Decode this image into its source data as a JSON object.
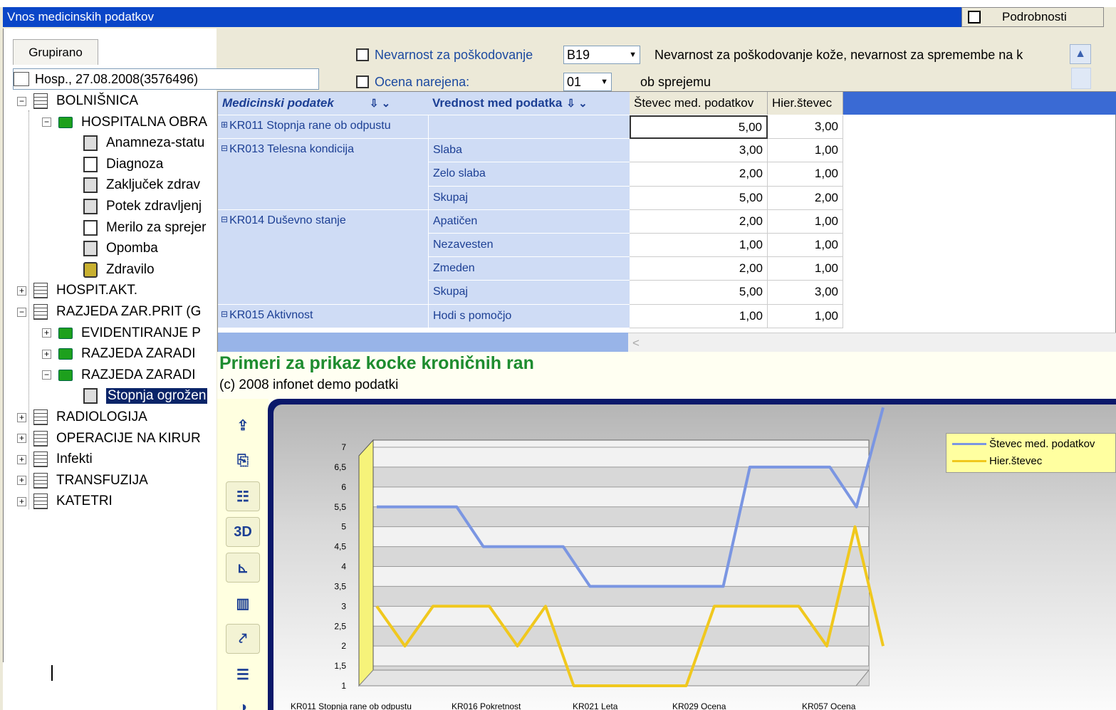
{
  "window": {
    "title": "Vnos medicinskih podatkov",
    "details_label": "Podrobnosti"
  },
  "left": {
    "tab_label": "Grupirano",
    "patient_selector": "Hosp., 27.08.2008(3576496)",
    "tree": [
      {
        "label": "BOLNIŠNICA",
        "toggle": "−",
        "icon": "database-icon"
      },
      {
        "label": "HOSPITALNA OBRA",
        "toggle": "−",
        "icon": "folder-icon"
      },
      {
        "label": "Anamneza-statu",
        "icon": "form-icon"
      },
      {
        "label": "Diagnoza",
        "icon": "document-icon"
      },
      {
        "label": "Zaključek zdrav",
        "icon": "form-icon"
      },
      {
        "label": "Potek zdravljenj",
        "icon": "form-icon"
      },
      {
        "label": "Merilo za sprejer",
        "icon": "blank-document-icon"
      },
      {
        "label": "Opomba",
        "icon": "note-icon"
      },
      {
        "label": "Zdravilo",
        "icon": "medicine-icon"
      },
      {
        "label": "HOSPIT.AKT.",
        "toggle": "+",
        "icon": "database-icon"
      },
      {
        "label": "RAZJEDA ZAR.PRIT (G",
        "toggle": "−",
        "icon": "database-icon"
      },
      {
        "label": "EVIDENTIRANJE P",
        "toggle": "+",
        "icon": "folder-icon"
      },
      {
        "label": "RAZJEDA ZARADI",
        "toggle": "+",
        "icon": "folder-icon"
      },
      {
        "label": "RAZJEDA ZARADI",
        "toggle": "−",
        "icon": "folder-icon"
      },
      {
        "label": "Stopnja ogrožen",
        "icon": "note-icon",
        "selected": true
      },
      {
        "label": "RADIOLOGIJA",
        "toggle": "+",
        "icon": "database-icon"
      },
      {
        "label": "OPERACIJE NA KIRUR",
        "toggle": "+",
        "icon": "database-icon"
      },
      {
        "label": "Infekti",
        "toggle": "+",
        "icon": "database-icon"
      },
      {
        "label": "TRANSFUZIJA",
        "toggle": "+",
        "icon": "database-icon"
      },
      {
        "label": "KATETRI",
        "toggle": "+",
        "icon": "database-icon"
      }
    ]
  },
  "fields": {
    "risk_label": "Nevarnost za poškodovanje",
    "risk_value": "B19",
    "risk_description": "Nevarnost za poškodovanje kože, nevarnost za spremembe na k",
    "assessment_label": "Ocena narejena:",
    "assessment_value": "01",
    "assessment_description": "ob sprejemu"
  },
  "grid": {
    "headers": {
      "medical": "Medicinski podatek",
      "value": "Vrednost med podatka",
      "count": "Števec med. podatkov",
      "hier": "Hier.števec"
    },
    "groups": [
      {
        "name": "KR011 Stopnja rane ob odpustu",
        "toggle": "+",
        "rows": [
          {
            "value": "",
            "count": "5,00",
            "hier": "3,00"
          }
        ]
      },
      {
        "name": "KR013 Telesna kondicija",
        "toggle": "−",
        "rows": [
          {
            "value": "Slaba",
            "count": "3,00",
            "hier": "1,00"
          },
          {
            "value": "Zelo slaba",
            "count": "2,00",
            "hier": "1,00"
          },
          {
            "value": "Skupaj",
            "count": "5,00",
            "hier": "2,00"
          }
        ]
      },
      {
        "name": "KR014 Duševno stanje",
        "toggle": "−",
        "rows": [
          {
            "value": "Apatičen",
            "count": "2,00",
            "hier": "1,00"
          },
          {
            "value": "Nezavesten",
            "count": "1,00",
            "hier": "1,00"
          },
          {
            "value": "Zmeden",
            "count": "2,00",
            "hier": "1,00"
          },
          {
            "value": "Skupaj",
            "count": "5,00",
            "hier": "3,00"
          }
        ]
      },
      {
        "name": "KR015 Aktivnost",
        "toggle": "−",
        "rows": [
          {
            "value": "Hodi s pomočjo",
            "count": "1,00",
            "hier": "1,00"
          }
        ]
      }
    ]
  },
  "chart_panel": {
    "title": "Primeri za prikaz kocke kroničnih ran",
    "subtitle": "(c) 2008 infonet demo podatki",
    "toolbar_3d_label": "3D"
  },
  "chart_data": {
    "type": "line",
    "title": "",
    "xlabel": "",
    "ylabel": "",
    "ylim": [
      1,
      7
    ],
    "y_ticks": [
      "1",
      "1,5",
      "2",
      "2,5",
      "3",
      "3,5",
      "4",
      "4,5",
      "5",
      "5,5",
      "6",
      "6,5",
      "7"
    ],
    "x_tick_labels": [
      "KR011 Stopnja rane ob odpustu",
      "KR016 Pokretnost",
      "KR021 Leta",
      "KR029 Ocena",
      "KR057 Ocena"
    ],
    "three_d": true,
    "grid": true,
    "legend_position": "top-right",
    "series": [
      {
        "name": "Števec med. podatkov",
        "color": "#7b96e2",
        "values": [
          5.5,
          5.5,
          5.5,
          5.5,
          4.5,
          4.5,
          4.5,
          4.5,
          3.5,
          3.5,
          3.5,
          3.5,
          3.5,
          3.5,
          6.5,
          6.5,
          6.5,
          6.5,
          5.5,
          8
        ]
      },
      {
        "name": "Hier.števec",
        "color": "#f0c81e",
        "values": [
          3,
          2,
          3,
          3,
          3,
          2,
          3,
          1,
          1,
          1,
          1,
          1,
          3,
          3,
          3,
          3,
          2,
          5,
          2
        ]
      }
    ]
  }
}
